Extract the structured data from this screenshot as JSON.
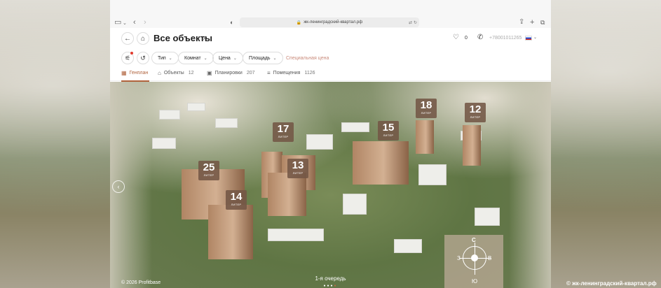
{
  "browser": {
    "url": "жк-ленинградский-квартал.рф"
  },
  "header": {
    "title": "Все объекты",
    "favorites_count": "0",
    "phone": "+78001011265"
  },
  "filters": {
    "type": "Тип",
    "rooms": "Комнат",
    "price": "Цена",
    "area": "Площадь",
    "special": "Специальная цена"
  },
  "tabs": [
    {
      "label": "Генплан",
      "count": ""
    },
    {
      "label": "Объекты",
      "count": "12"
    },
    {
      "label": "Планировки",
      "count": "207"
    },
    {
      "label": "Помещения",
      "count": "1126"
    }
  ],
  "map": {
    "buildings": [
      {
        "number": "17",
        "sub": "ЛИТЕР"
      },
      {
        "number": "13",
        "sub": "ЛИТЕР"
      },
      {
        "number": "15",
        "sub": "ЛИТЕР"
      },
      {
        "number": "18",
        "sub": "ЛИТЕР"
      },
      {
        "number": "12",
        "sub": "ЛИТЕР"
      },
      {
        "number": "25",
        "sub": "ЛИТЕР"
      },
      {
        "number": "14",
        "sub": "ЛИТЕР"
      }
    ],
    "compass": {
      "north": "С",
      "south": "Ю",
      "west": "З",
      "east": "В"
    },
    "queue_label": "1-я очередь"
  },
  "footer": {
    "copyright": "© 2026 Profitbase"
  },
  "watermark": "© жк-ленинградский-квартал.рф"
}
